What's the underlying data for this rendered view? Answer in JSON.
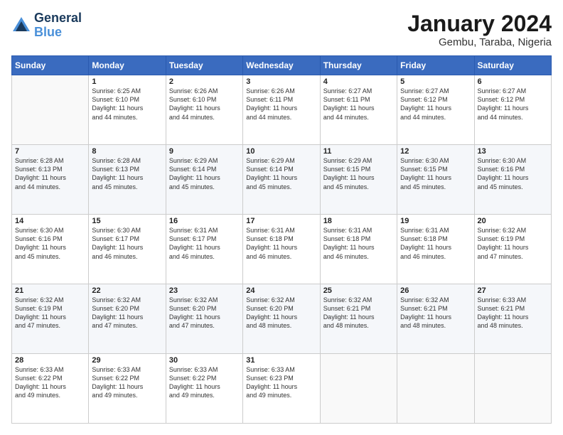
{
  "logo": {
    "general": "General",
    "blue": "Blue"
  },
  "header": {
    "month": "January 2024",
    "location": "Gembu, Taraba, Nigeria"
  },
  "weekdays": [
    "Sunday",
    "Monday",
    "Tuesday",
    "Wednesday",
    "Thursday",
    "Friday",
    "Saturday"
  ],
  "weeks": [
    [
      {
        "day": "",
        "info": ""
      },
      {
        "day": "1",
        "info": "Sunrise: 6:25 AM\nSunset: 6:10 PM\nDaylight: 11 hours\nand 44 minutes."
      },
      {
        "day": "2",
        "info": "Sunrise: 6:26 AM\nSunset: 6:10 PM\nDaylight: 11 hours\nand 44 minutes."
      },
      {
        "day": "3",
        "info": "Sunrise: 6:26 AM\nSunset: 6:11 PM\nDaylight: 11 hours\nand 44 minutes."
      },
      {
        "day": "4",
        "info": "Sunrise: 6:27 AM\nSunset: 6:11 PM\nDaylight: 11 hours\nand 44 minutes."
      },
      {
        "day": "5",
        "info": "Sunrise: 6:27 AM\nSunset: 6:12 PM\nDaylight: 11 hours\nand 44 minutes."
      },
      {
        "day": "6",
        "info": "Sunrise: 6:27 AM\nSunset: 6:12 PM\nDaylight: 11 hours\nand 44 minutes."
      }
    ],
    [
      {
        "day": "7",
        "info": "Sunrise: 6:28 AM\nSunset: 6:13 PM\nDaylight: 11 hours\nand 44 minutes."
      },
      {
        "day": "8",
        "info": "Sunrise: 6:28 AM\nSunset: 6:13 PM\nDaylight: 11 hours\nand 45 minutes."
      },
      {
        "day": "9",
        "info": "Sunrise: 6:29 AM\nSunset: 6:14 PM\nDaylight: 11 hours\nand 45 minutes."
      },
      {
        "day": "10",
        "info": "Sunrise: 6:29 AM\nSunset: 6:14 PM\nDaylight: 11 hours\nand 45 minutes."
      },
      {
        "day": "11",
        "info": "Sunrise: 6:29 AM\nSunset: 6:15 PM\nDaylight: 11 hours\nand 45 minutes."
      },
      {
        "day": "12",
        "info": "Sunrise: 6:30 AM\nSunset: 6:15 PM\nDaylight: 11 hours\nand 45 minutes."
      },
      {
        "day": "13",
        "info": "Sunrise: 6:30 AM\nSunset: 6:16 PM\nDaylight: 11 hours\nand 45 minutes."
      }
    ],
    [
      {
        "day": "14",
        "info": "Sunrise: 6:30 AM\nSunset: 6:16 PM\nDaylight: 11 hours\nand 45 minutes."
      },
      {
        "day": "15",
        "info": "Sunrise: 6:30 AM\nSunset: 6:17 PM\nDaylight: 11 hours\nand 46 minutes."
      },
      {
        "day": "16",
        "info": "Sunrise: 6:31 AM\nSunset: 6:17 PM\nDaylight: 11 hours\nand 46 minutes."
      },
      {
        "day": "17",
        "info": "Sunrise: 6:31 AM\nSunset: 6:18 PM\nDaylight: 11 hours\nand 46 minutes."
      },
      {
        "day": "18",
        "info": "Sunrise: 6:31 AM\nSunset: 6:18 PM\nDaylight: 11 hours\nand 46 minutes."
      },
      {
        "day": "19",
        "info": "Sunrise: 6:31 AM\nSunset: 6:18 PM\nDaylight: 11 hours\nand 46 minutes."
      },
      {
        "day": "20",
        "info": "Sunrise: 6:32 AM\nSunset: 6:19 PM\nDaylight: 11 hours\nand 47 minutes."
      }
    ],
    [
      {
        "day": "21",
        "info": "Sunrise: 6:32 AM\nSunset: 6:19 PM\nDaylight: 11 hours\nand 47 minutes."
      },
      {
        "day": "22",
        "info": "Sunrise: 6:32 AM\nSunset: 6:20 PM\nDaylight: 11 hours\nand 47 minutes."
      },
      {
        "day": "23",
        "info": "Sunrise: 6:32 AM\nSunset: 6:20 PM\nDaylight: 11 hours\nand 47 minutes."
      },
      {
        "day": "24",
        "info": "Sunrise: 6:32 AM\nSunset: 6:20 PM\nDaylight: 11 hours\nand 48 minutes."
      },
      {
        "day": "25",
        "info": "Sunrise: 6:32 AM\nSunset: 6:21 PM\nDaylight: 11 hours\nand 48 minutes."
      },
      {
        "day": "26",
        "info": "Sunrise: 6:32 AM\nSunset: 6:21 PM\nDaylight: 11 hours\nand 48 minutes."
      },
      {
        "day": "27",
        "info": "Sunrise: 6:33 AM\nSunset: 6:21 PM\nDaylight: 11 hours\nand 48 minutes."
      }
    ],
    [
      {
        "day": "28",
        "info": "Sunrise: 6:33 AM\nSunset: 6:22 PM\nDaylight: 11 hours\nand 49 minutes."
      },
      {
        "day": "29",
        "info": "Sunrise: 6:33 AM\nSunset: 6:22 PM\nDaylight: 11 hours\nand 49 minutes."
      },
      {
        "day": "30",
        "info": "Sunrise: 6:33 AM\nSunset: 6:22 PM\nDaylight: 11 hours\nand 49 minutes."
      },
      {
        "day": "31",
        "info": "Sunrise: 6:33 AM\nSunset: 6:23 PM\nDaylight: 11 hours\nand 49 minutes."
      },
      {
        "day": "",
        "info": ""
      },
      {
        "day": "",
        "info": ""
      },
      {
        "day": "",
        "info": ""
      }
    ]
  ]
}
